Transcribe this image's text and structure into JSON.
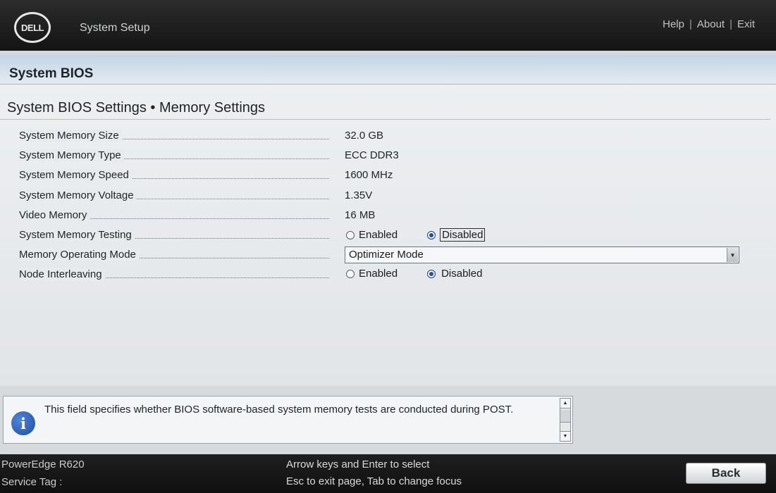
{
  "header": {
    "logo_text": "DELL",
    "title": "System Setup",
    "links": {
      "help": "Help",
      "about": "About",
      "exit": "Exit",
      "separator": "|"
    }
  },
  "main": {
    "section_title": "System BIOS",
    "page_title": "System BIOS Settings • Memory Settings",
    "settings": [
      {
        "label": "System Memory Size",
        "value": "32.0 GB"
      },
      {
        "label": "System Memory Type",
        "value": "ECC DDR3"
      },
      {
        "label": "System Memory Speed",
        "value": "1600 MHz"
      },
      {
        "label": "System Memory Voltage",
        "value": "1.35V"
      },
      {
        "label": "Video Memory",
        "value": "16 MB"
      },
      {
        "label": "System Memory Testing",
        "options": [
          "Enabled",
          "Disabled"
        ],
        "selected": "Disabled"
      },
      {
        "label": "Memory Operating Mode",
        "value": "Optimizer Mode"
      },
      {
        "label": "Node Interleaving",
        "options": [
          "Enabled",
          "Disabled"
        ],
        "selected": "Disabled"
      }
    ]
  },
  "help_panel": {
    "icon": "info-icon",
    "text": "This field specifies whether BIOS software-based system memory tests are conducted during POST."
  },
  "footer": {
    "model": "PowerEdge R620",
    "service_tag_label": "Service Tag :",
    "hint_line1": "Arrow keys and Enter to select",
    "hint_line2": "Esc to exit page, Tab to change focus",
    "back_label": "Back"
  },
  "colors": {
    "header_bg": "#1a1a1a",
    "panel_bg": "#e8ebee",
    "section_strip": "#d3e0ec",
    "radio_checked": "#1d4fa3",
    "info_icon": "#2a5fb8"
  }
}
